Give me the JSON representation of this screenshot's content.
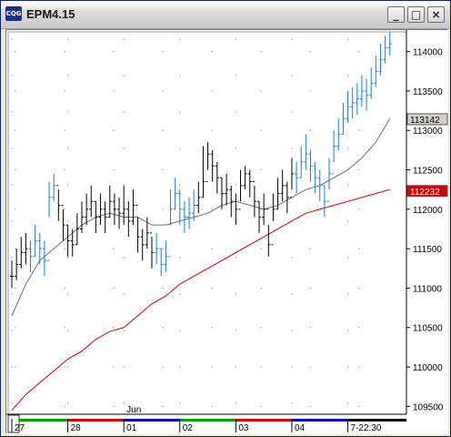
{
  "window": {
    "title": "EPM4.15",
    "icon_label": "CQG",
    "buttons": [
      {
        "name": "minimize-button",
        "glyph": "_"
      },
      {
        "name": "maximize-button",
        "glyph": "□"
      },
      {
        "name": "close-button",
        "glyph": "×"
      }
    ]
  },
  "chart_data": {
    "type": "line",
    "instrument": "EPM4.15",
    "ylim": [
      109400,
      114250
    ],
    "y_ticks": [
      109500,
      110000,
      110500,
      111000,
      111500,
      112000,
      112500,
      113000,
      113500,
      114000
    ],
    "y_tick_labels": [
      "109500",
      "110000",
      "110500",
      "111000",
      "111500",
      "112000",
      "112500",
      "113000",
      "113500",
      "114000"
    ],
    "x_labels": [
      {
        "text": "27",
        "at": 0
      },
      {
        "text": "28",
        "at": 24
      },
      {
        "text": "01",
        "at": 48
      },
      {
        "text": "02",
        "at": 72
      },
      {
        "text": "03",
        "at": 96
      },
      {
        "text": "04",
        "at": 120
      },
      {
        "text": "7-22:30",
        "at": 144
      }
    ],
    "x_sublabel": {
      "text": "Jun",
      "at": 48
    },
    "day_colors": [
      "#00a000",
      "#d00000",
      "#0000cc",
      "#00a000",
      "#d00000",
      "#0000cc",
      "#000000"
    ],
    "price_tags": [
      {
        "text": "113142",
        "value": 113142,
        "bg": "#d4d0c8",
        "color": "#000000"
      },
      {
        "text": "112232",
        "value": 112232,
        "bg": "#d00000",
        "color": "#ffffff"
      }
    ],
    "series": [
      {
        "kind": "ohlc-bars",
        "x": [
          0,
          2,
          4,
          6,
          8,
          10,
          12,
          14,
          16,
          18,
          20,
          22,
          24,
          26,
          28,
          30,
          32,
          34,
          36,
          38,
          40,
          42,
          44,
          46,
          48,
          50,
          52,
          54,
          56,
          58,
          60,
          62,
          64,
          66,
          68,
          70,
          72,
          74,
          76,
          78,
          80,
          82,
          84,
          86,
          88,
          90,
          92,
          94,
          96,
          98,
          100,
          102,
          104,
          106,
          108,
          110,
          112,
          114,
          116,
          118,
          120,
          122,
          124,
          126,
          128,
          130,
          132,
          134,
          136,
          138,
          140,
          142,
          144,
          146,
          148,
          150,
          152,
          154,
          156,
          158,
          160,
          162
        ],
        "close": [
          111150,
          111300,
          111450,
          111500,
          111400,
          111600,
          111500,
          111350,
          112150,
          112300,
          112050,
          111800,
          111600,
          111550,
          111750,
          111900,
          112000,
          112100,
          111900,
          112000,
          111900,
          112100,
          112000,
          111950,
          112000,
          111850,
          112050,
          111650,
          111550,
          111700,
          111450,
          111500,
          111300,
          111400,
          112000,
          112200,
          112000,
          111900,
          111950,
          112050,
          112150,
          112350,
          112700,
          112550,
          112400,
          112200,
          112250,
          112100,
          112000,
          112300,
          112450,
          112350,
          112100,
          111900,
          112000,
          111550,
          112000,
          112200,
          112300,
          112150,
          112450,
          112400,
          112600,
          112700,
          112550,
          112400,
          112300,
          112100,
          112450,
          112800,
          112950,
          113150,
          113300,
          113350,
          113400,
          113500,
          113450,
          113600,
          113750,
          113900,
          114050,
          114100
        ],
        "high": [
          111350,
          111500,
          111650,
          111700,
          111600,
          111800,
          111700,
          111600,
          112350,
          112450,
          112250,
          112000,
          111800,
          111750,
          111950,
          112100,
          112200,
          112300,
          112100,
          112200,
          112100,
          112300,
          112200,
          112150,
          112300,
          112100,
          112250,
          111900,
          111750,
          111900,
          111650,
          111700,
          111500,
          111600,
          112250,
          112400,
          112250,
          112100,
          112150,
          112250,
          112350,
          112800,
          112850,
          112750,
          112600,
          112400,
          112450,
          112300,
          112200,
          112500,
          112550,
          112500,
          112300,
          112100,
          112200,
          111800,
          112200,
          112400,
          112500,
          112350,
          112650,
          112600,
          112800,
          112950,
          112750,
          112600,
          112500,
          112300,
          112650,
          113000,
          113150,
          113350,
          113500,
          113550,
          113600,
          113700,
          113650,
          113800,
          113950,
          114100,
          114200,
          114250
        ],
        "low": [
          111000,
          111100,
          111250,
          111300,
          111200,
          111400,
          111300,
          111150,
          111900,
          112100,
          111850,
          111600,
          111400,
          111400,
          111550,
          111700,
          111800,
          111900,
          111700,
          111800,
          111700,
          111900,
          111800,
          111750,
          111800,
          111650,
          111800,
          111450,
          111350,
          111500,
          111250,
          111300,
          111150,
          111200,
          111800,
          112000,
          111800,
          111700,
          111750,
          111850,
          111950,
          112150,
          112500,
          112350,
          112200,
          112000,
          112050,
          111900,
          111800,
          112100,
          112250,
          112150,
          111900,
          111700,
          111800,
          111400,
          111850,
          112000,
          112100,
          111950,
          112250,
          112200,
          112400,
          112500,
          112350,
          112200,
          112100,
          111900,
          112250,
          112600,
          112750,
          112950,
          113100,
          113150,
          113200,
          113300,
          113250,
          113400,
          113550,
          113700,
          113850,
          113950
        ],
        "colors_note_blue_x": [
          8,
          10,
          12,
          14,
          16,
          18,
          62,
          64,
          66,
          68,
          70,
          72,
          74,
          76,
          78,
          122,
          124,
          126,
          128,
          130,
          132,
          134,
          136,
          138,
          140,
          142,
          144,
          146,
          148,
          150,
          152,
          154,
          156,
          158,
          160,
          162
        ]
      },
      {
        "kind": "moving-average",
        "color": "#707070",
        "x": [
          0,
          6,
          12,
          18,
          24,
          30,
          36,
          42,
          48,
          54,
          60,
          66,
          72,
          78,
          84,
          90,
          96,
          102,
          108,
          114,
          120,
          126,
          132,
          138,
          144,
          150,
          156,
          162
        ],
        "values": [
          110650,
          111050,
          111350,
          111500,
          111650,
          111800,
          111900,
          111950,
          111900,
          111900,
          111800,
          111800,
          111850,
          111900,
          111950,
          112050,
          112100,
          112050,
          112000,
          112050,
          112150,
          112250,
          112300,
          112400,
          112500,
          112650,
          112850,
          113150
        ]
      },
      {
        "kind": "moving-average",
        "color": "#cc0000",
        "x": [
          0,
          6,
          12,
          18,
          24,
          30,
          36,
          42,
          48,
          54,
          60,
          66,
          72,
          78,
          84,
          90,
          96,
          102,
          108,
          114,
          120,
          126,
          132,
          138,
          144,
          150,
          156,
          162
        ],
        "values": [
          109450,
          109650,
          109800,
          109950,
          110100,
          110200,
          110350,
          110450,
          110500,
          110650,
          110800,
          110900,
          111050,
          111150,
          111250,
          111350,
          111450,
          111550,
          111650,
          111750,
          111850,
          111950,
          112000,
          112050,
          112100,
          112150,
          112200,
          112250
        ]
      }
    ]
  }
}
